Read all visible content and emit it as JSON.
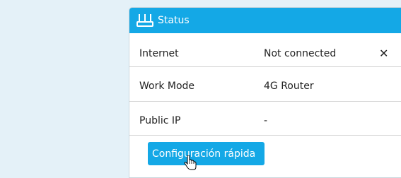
{
  "status_panel": {
    "title": "Status",
    "icon": "router-icon",
    "rows": [
      {
        "label": "Internet",
        "value": "Not connected",
        "action_icon": "close-icon",
        "action_glyph": "✕"
      },
      {
        "label": "Work Mode",
        "value": "4G Router"
      },
      {
        "label": "Public IP",
        "value": "-"
      }
    ],
    "quick_setup_label": "Configuración rápida"
  },
  "colors": {
    "accent": "#14a8e6",
    "page_background": "#e4f1f8",
    "panel_background": "#ffffff"
  }
}
